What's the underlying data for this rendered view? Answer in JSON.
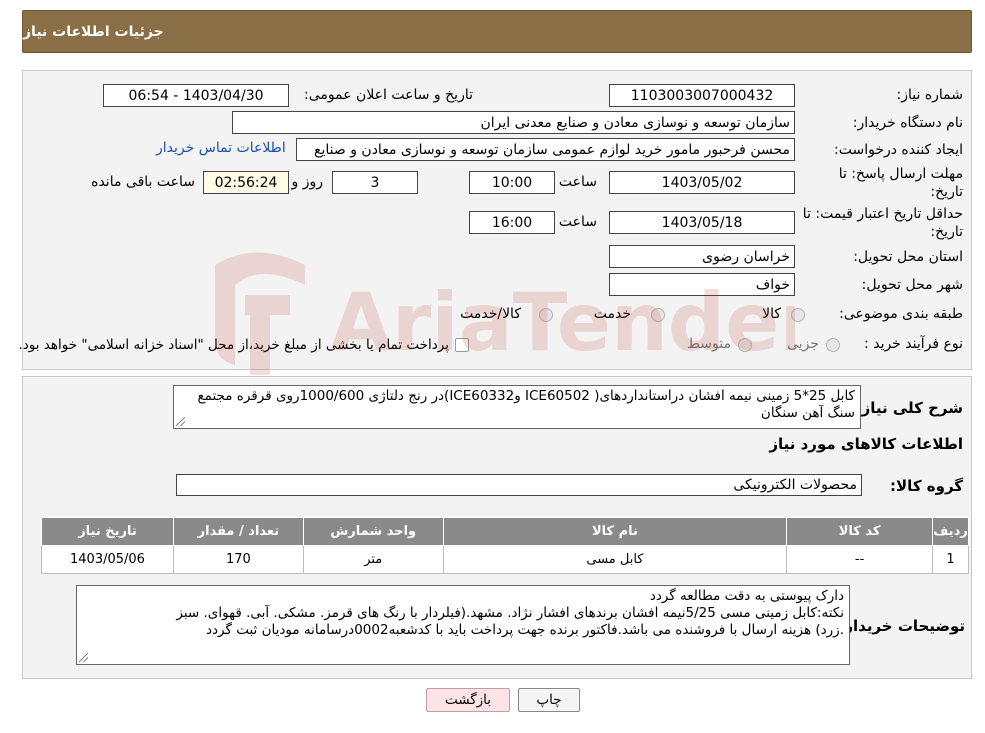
{
  "header": {
    "title": "جزئیات اطلاعات نیاز"
  },
  "form": {
    "need_number_label": "شماره نیاز:",
    "need_number": "1103003007000432",
    "announce_label": "تاریخ و ساعت اعلان عمومی:",
    "announce_value": "1403/04/30 - 06:54",
    "buyer_org_label": "نام دستگاه خریدار:",
    "buyer_org": "سازمان توسعه و نوسازی معادن و صنایع معدنی ایران",
    "creator_label": "ایجاد کننده درخواست:",
    "creator": "محسن فرحبور مامور خرید لوازم عمومی سازمان توسعه و نوسازی معادن و صنایع",
    "contact_link": "اطلاعات تماس خریدار",
    "reply_deadline_label_1": "مهلت ارسال پاسخ: تا",
    "reply_deadline_label_2": "تاریخ:",
    "reply_date": "1403/05/02",
    "time_label": "ساعت",
    "reply_time": "10:00",
    "days_value": "3",
    "days_label": "روز و",
    "remaining_time": "02:56:24",
    "remaining_label": "ساعت باقی مانده",
    "price_validity_label_1": "حداقل تاریخ اعتبار قیمت: تا",
    "price_validity_label_2": "تاریخ:",
    "validity_date": "1403/05/18",
    "validity_time": "16:00",
    "province_label": "استان محل تحویل:",
    "province": "خراسان رضوی",
    "city_label": "شهر محل تحویل:",
    "city": "خواف",
    "category_label": "طبقه بندی موضوعی:",
    "category_options": [
      "کالا",
      "خدمت",
      "کالا/خدمت"
    ],
    "purchase_type_label": "نوع فرآیند خرید :",
    "purchase_options": [
      "جزیی",
      "متوسط"
    ],
    "purchase_note": "پرداخت تمام یا بخشی از مبلغ خرید،از محل \"اسناد خزانه اسلامی\" خواهد بود."
  },
  "description": {
    "label": "شرح کلی نیاز:",
    "text": "کابل 25*5 زمینی نیمه افشان دراستانداردهای( ICE60502 وICE60332)در رنج دلتاژی 1000/600روی قرقره مجتمع سنگ آهن سنگان"
  },
  "goods_section": {
    "title": "اطلاعات کالاهای مورد نیاز",
    "group_label": "گروه کالا:",
    "group_value": "محصولات الکترونیکی"
  },
  "table": {
    "headers": [
      "ردیف",
      "کد کالا",
      "نام کالا",
      "واحد شمارش",
      "تعداد / مقدار",
      "تاریخ نیاز"
    ],
    "rows": [
      [
        "1",
        "--",
        "کابل مسی",
        "متر",
        "170",
        "1403/05/06"
      ]
    ]
  },
  "buyer_notes": {
    "label": "توضیحات خریدار:",
    "lines": [
      "دارک پیوستی به دقت مطالعه گردد",
      "نکته:کابل زمینی مسی 5/25نیمه افشان برندهای افشار نژاد. مشهد.(فیلردار با رنگ های قرمز. مشکی. آبی. قهوای. سبز",
      ".زرد) هزینه ارسال با فروشنده می باشد.فاکتور برنده جهت پرداخت  باید با کدشعبه0002درسامانه مودیان ثبت گردد"
    ]
  },
  "buttons": {
    "print": "چاپ",
    "back": "بازگشت"
  },
  "watermark": {
    "text": "AriaTender.neT",
    "color": "#c0392b"
  }
}
